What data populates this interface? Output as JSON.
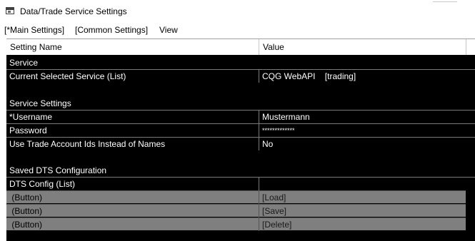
{
  "window": {
    "title": "Data/Trade Service Settings"
  },
  "menu": {
    "items": [
      "[*Main Settings]",
      "[Common Settings]",
      "View"
    ]
  },
  "grid": {
    "columns": [
      "Setting Name",
      "Value"
    ],
    "sections": [
      {
        "title": "Service",
        "rows": [
          {
            "name": "Current Selected Service (List)",
            "value": "CQG WebAPI    [trading]"
          }
        ]
      },
      {
        "title": "Service Settings",
        "rows": [
          {
            "name": "*Username",
            "value": "Mustermann"
          },
          {
            "name": "Password",
            "value": "*************"
          },
          {
            "name": "Use Trade Account Ids Instead of Names",
            "value": "No"
          }
        ]
      },
      {
        "title": "Saved DTS Configuration",
        "rows": [
          {
            "name": "DTS Config (List)",
            "value": ""
          },
          {
            "name": " (Button)",
            "value": "[Load]"
          },
          {
            "name": " (Button)",
            "value": "[Save]"
          },
          {
            "name": " (Button)",
            "value": "[Delete]"
          }
        ]
      }
    ]
  }
}
